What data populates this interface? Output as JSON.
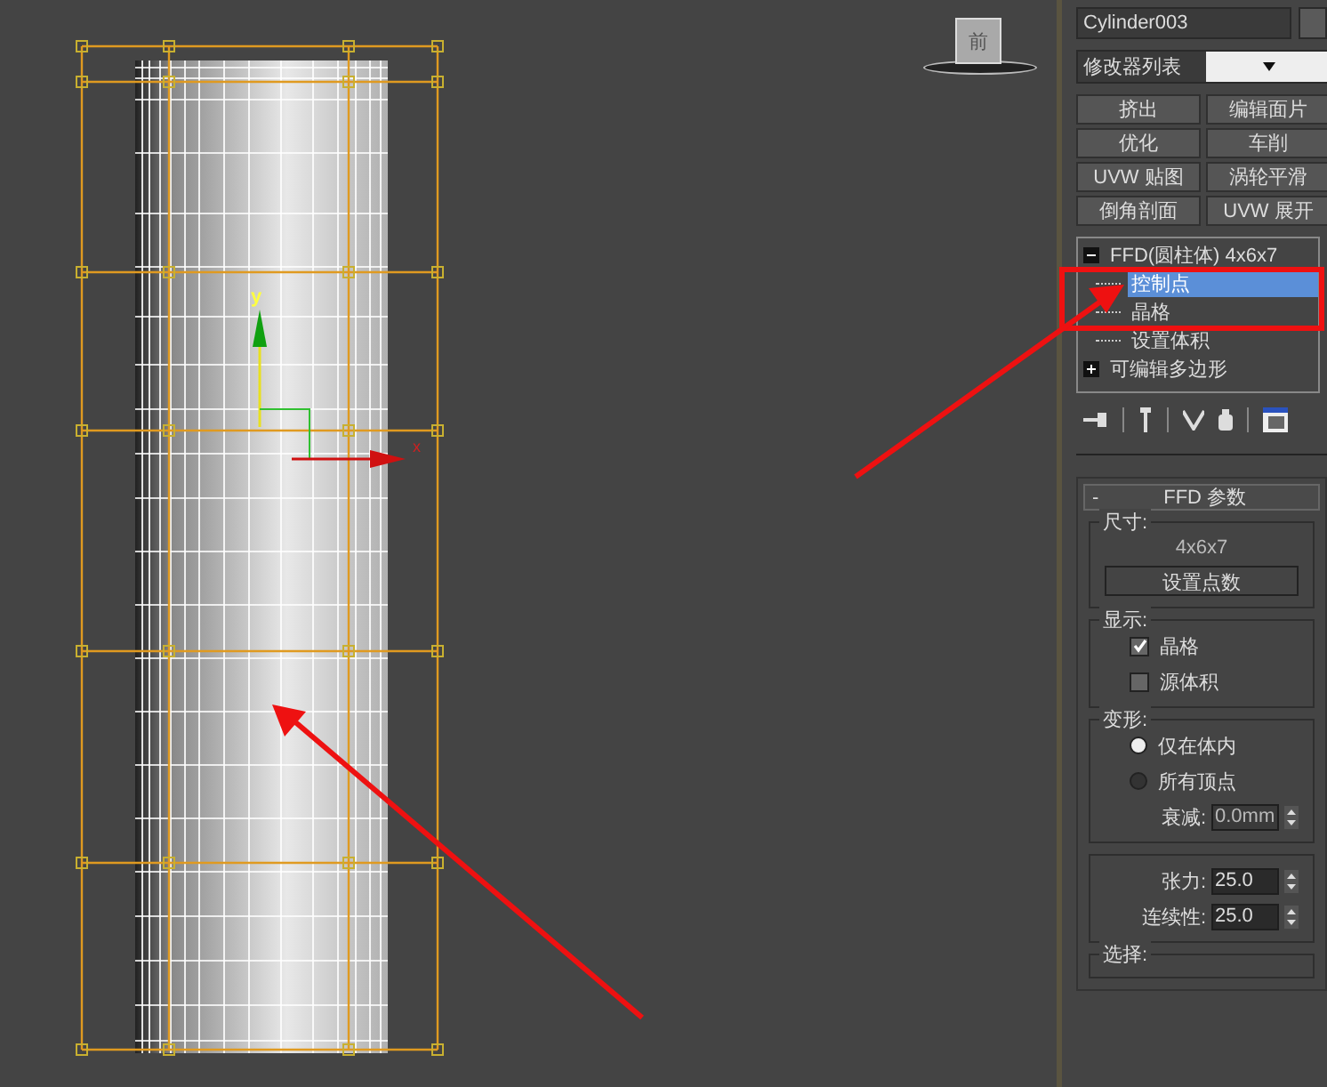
{
  "viewport": {
    "viewcube_label": "前",
    "axis_labels": [
      "y",
      "x"
    ]
  },
  "command_panel": {
    "object_name": "Cylinder003",
    "modifier_list": "修改器列表",
    "modifier_buttons": [
      "挤出",
      "编辑面片",
      "优化",
      "车削",
      "UVW 贴图",
      "涡轮平滑",
      "倒角剖面",
      "UVW 展开"
    ],
    "modifier_stack": [
      {
        "label": "FFD(圆柱体) 4x6x7",
        "expanded": true,
        "selected": false,
        "children": [
          {
            "label": "控制点",
            "selected": true
          },
          {
            "label": "晶格",
            "selected": false
          },
          {
            "label": "设置体积",
            "selected": false
          }
        ]
      },
      {
        "label": "可编辑多边形",
        "expanded": false,
        "selected": false
      }
    ],
    "rollout": {
      "title": "FFD 参数",
      "collapse_toggle": "-",
      "groups": [
        {
          "title": "尺寸:",
          "items": [
            {
              "kind": "readout",
              "text": "4x6x7"
            },
            {
              "kind": "button",
              "label": "设置点数"
            }
          ]
        },
        {
          "title": "显示:",
          "items": [
            {
              "kind": "checkbox",
              "label": "晶格",
              "checked": true
            },
            {
              "kind": "checkbox",
              "label": "源体积",
              "checked": false
            }
          ]
        },
        {
          "title": "变形:",
          "items": [
            {
              "kind": "radio",
              "label": "仅在体内",
              "selected": true
            },
            {
              "kind": "radio",
              "label": "所有顶点",
              "selected": false
            },
            {
              "kind": "spinner",
              "label": "衰减:",
              "value": "0.0mm",
              "disabled": true
            }
          ]
        },
        {
          "items": [
            {
              "kind": "spinner",
              "label": "张力:",
              "value": "25.0",
              "disabled": false
            },
            {
              "kind": "spinner",
              "label": "连续性:",
              "value": "25.0",
              "disabled": false
            }
          ]
        },
        {
          "title": "选择:"
        }
      ]
    }
  }
}
